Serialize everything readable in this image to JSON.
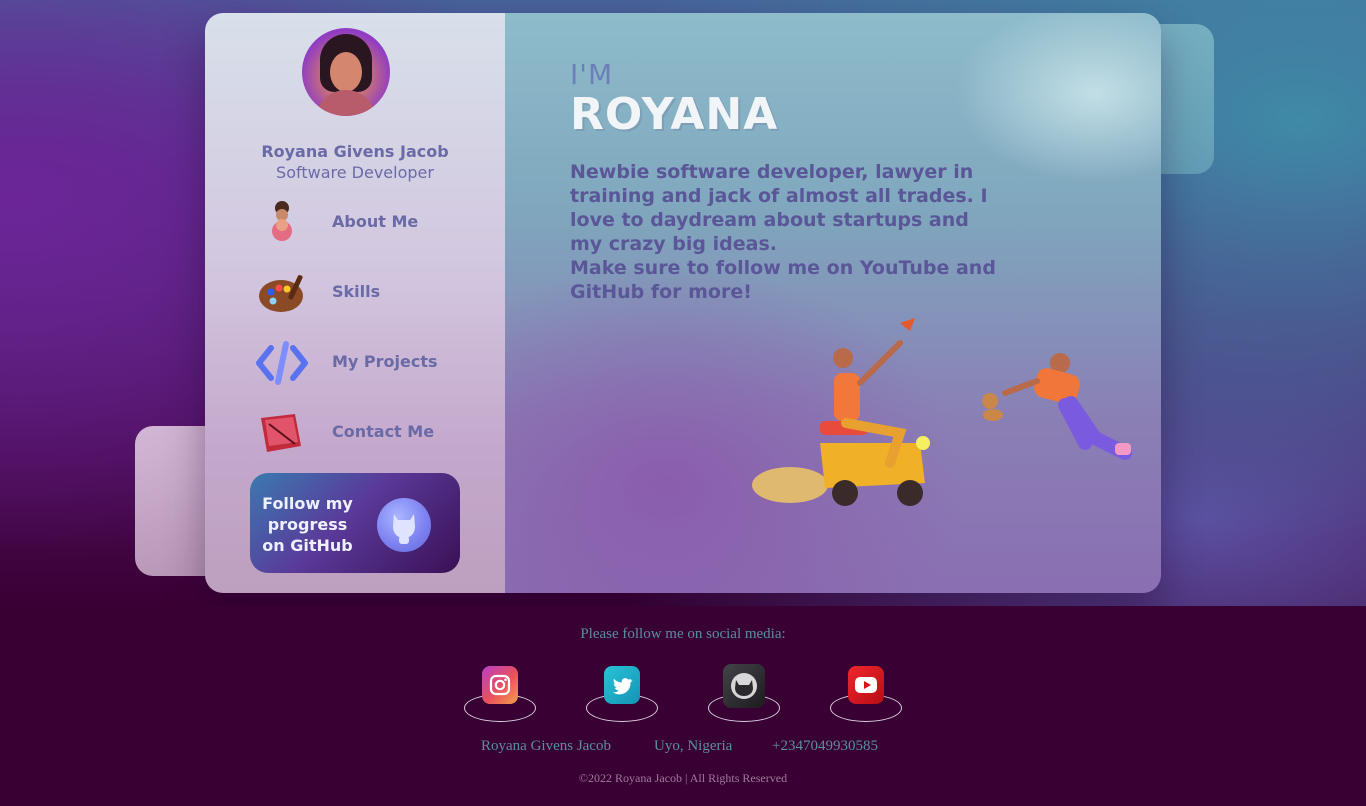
{
  "profile": {
    "name": "Royana Givens Jacob",
    "role": "Software Developer"
  },
  "nav": [
    {
      "label": "About Me",
      "icon": "person-figure-icon"
    },
    {
      "label": "Skills",
      "icon": "paint-palette-icon"
    },
    {
      "label": "My Projects",
      "icon": "code-brackets-icon"
    },
    {
      "label": "Contact Me",
      "icon": "notebook-icon"
    }
  ],
  "github_button": {
    "label": "Follow my progress on GitHub",
    "icon": "github-cat-icon"
  },
  "hero": {
    "intro": "I'M",
    "name": "ROYANA",
    "bio": "Newbie software developer, lawyer in training and jack of almost all trades. I love to daydream about startups and my crazy big ideas.",
    "cta": "Make sure to follow me on YouTube and GitHub for more!"
  },
  "footer": {
    "follow_text": "Please follow me on social media:",
    "socials": [
      {
        "name": "instagram",
        "icon": "instagram-icon",
        "color": "#d9603f"
      },
      {
        "name": "twitter",
        "icon": "twitter-icon",
        "color": "#1aa3c3"
      },
      {
        "name": "github",
        "icon": "github-icon",
        "color": "#2b2b2f"
      },
      {
        "name": "youtube",
        "icon": "youtube-icon",
        "color": "#d8141c"
      }
    ],
    "contact_name": "Royana Givens Jacob",
    "location": "Uyo, Nigeria",
    "phone": "+2347049930585",
    "copyright": "©2022 Royana Jacob | All Rights Reserved"
  },
  "colors": {
    "accent": "#6a6aa6",
    "footer_bg": "#390033",
    "footer_text": "#5b8ea0"
  }
}
